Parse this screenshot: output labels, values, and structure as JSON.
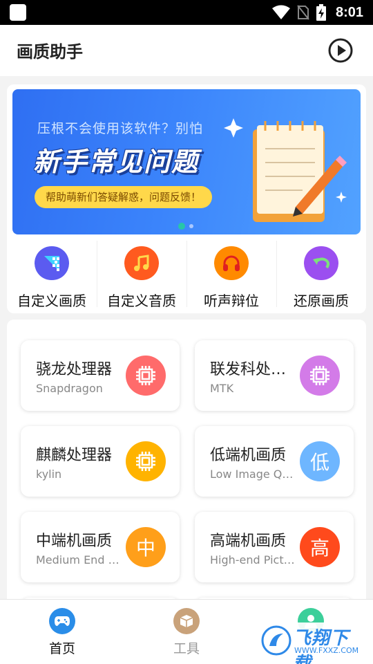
{
  "status_bar": {
    "time": "8:01"
  },
  "app_bar": {
    "title": "画质助手",
    "play_icon": "play-circle-icon"
  },
  "banner": {
    "subtitle": "压根不会使用该软件？别怕",
    "title": "新手常见问题",
    "pill": "帮助萌新们答疑解惑，问题反馈！",
    "page_count": 2,
    "active_page": 1
  },
  "quick_actions": [
    {
      "label": "自定义画质",
      "icon": "mosaic-icon",
      "color": "#5b5bf0"
    },
    {
      "label": "自定义音质",
      "icon": "music-note-icon",
      "color": "#ff5a1f"
    },
    {
      "label": "听声辩位",
      "icon": "headphones-icon",
      "color": "#ff8a00"
    },
    {
      "label": "还原画质",
      "icon": "undo-arrow-icon",
      "color": "#9b4ff0"
    }
  ],
  "tiles": [
    {
      "title": "骁龙处理器",
      "subtitle": "Snapdragon",
      "icon": "chip-icon",
      "color": "#ff6b6b"
    },
    {
      "title": "联发科处理器",
      "subtitle": "MTK",
      "icon": "chip-icon",
      "color": "#d37be8"
    },
    {
      "title": "麒麟处理器",
      "subtitle": "kylin",
      "icon": "chip-icon",
      "color": "#ffb300"
    },
    {
      "title": "低端机画质",
      "subtitle": "Low Image Quality",
      "icon_text": "低",
      "color": "#6eb6ff"
    },
    {
      "title": "中端机画质",
      "subtitle": "Medium End Picture",
      "icon_text": "中",
      "color": "#ff9f1a"
    },
    {
      "title": "高端机画质",
      "subtitle": "High-end Picture",
      "icon_text": "高",
      "color": "#ff4a1c"
    }
  ],
  "bottom_nav": [
    {
      "label": "首页",
      "icon": "gamepad-icon",
      "color": "#2a8de8",
      "active": true
    },
    {
      "label": "工具",
      "icon": "box-icon",
      "color": "#c9a27a",
      "active": false
    },
    {
      "label": "",
      "icon": "user-icon",
      "color": "#3ccf9a",
      "active": false
    }
  ],
  "watermark": {
    "text": "飞翔下载",
    "url": "WWW.FXXZ.COM"
  }
}
